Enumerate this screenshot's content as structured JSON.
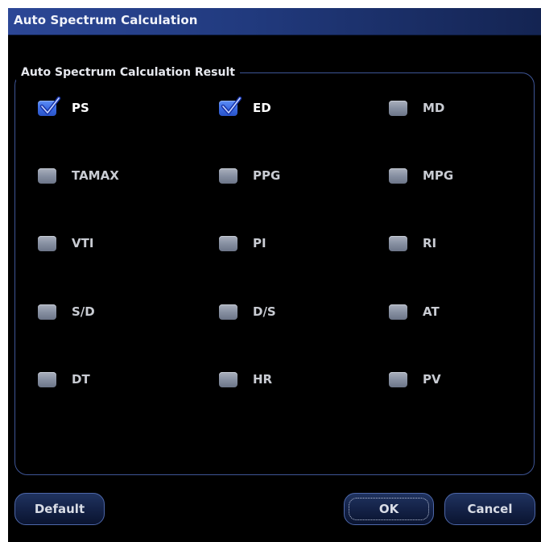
{
  "window": {
    "title": "Auto Spectrum Calculation"
  },
  "group": {
    "legend": "Auto Spectrum Calculation Result"
  },
  "items": [
    {
      "label": "PS",
      "checked": true
    },
    {
      "label": "ED",
      "checked": true
    },
    {
      "label": "MD",
      "checked": false
    },
    {
      "label": "TAMAX",
      "checked": false
    },
    {
      "label": "PPG",
      "checked": false
    },
    {
      "label": "MPG",
      "checked": false
    },
    {
      "label": "VTI",
      "checked": false
    },
    {
      "label": "PI",
      "checked": false
    },
    {
      "label": "RI",
      "checked": false
    },
    {
      "label": "S/D",
      "checked": false
    },
    {
      "label": "D/S",
      "checked": false
    },
    {
      "label": "AT",
      "checked": false
    },
    {
      "label": "DT",
      "checked": false
    },
    {
      "label": "HR",
      "checked": false
    },
    {
      "label": "PV",
      "checked": false
    }
  ],
  "buttons": {
    "default_label": "Default",
    "ok_label": "OK",
    "cancel_label": "Cancel"
  },
  "colors": {
    "title_bar": "#213a7e",
    "checked_box": "#3a69e1",
    "unchecked_box": "#8790a2",
    "group_border": "#3e5596",
    "background": "#000000"
  }
}
